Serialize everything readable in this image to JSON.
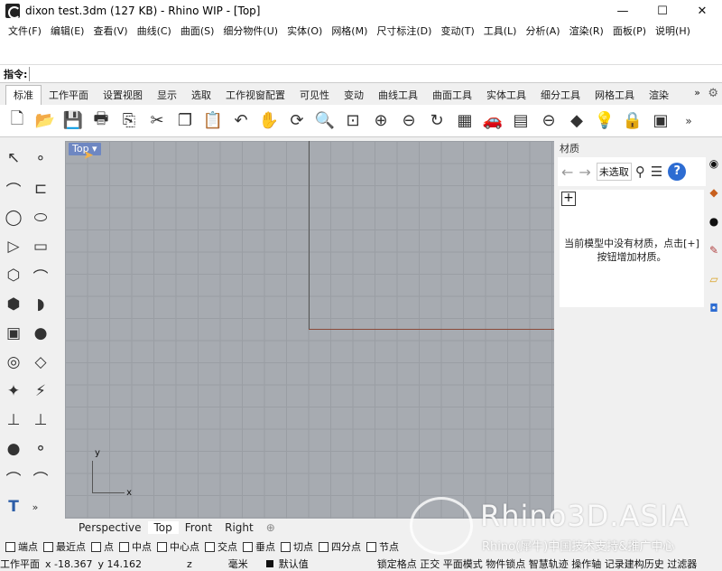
{
  "window": {
    "title": "dixon test.3dm (127 KB) - Rhino WIP - [Top]",
    "minimize": "—",
    "maximize": "☐",
    "close": "✕"
  },
  "menu": [
    "文件(F)",
    "编辑(E)",
    "查看(V)",
    "曲线(C)",
    "曲面(S)",
    "细分物件(U)",
    "实体(O)",
    "网格(M)",
    "尺寸标注(D)",
    "变动(T)",
    "工具(L)",
    "分析(A)",
    "渲染(R)",
    "面板(P)",
    "说明(H)"
  ],
  "command": {
    "label": "指令:",
    "value": ""
  },
  "tabs": [
    "标准",
    "工作平面",
    "设置视图",
    "显示",
    "选取",
    "工作视窗配置",
    "可见性",
    "变动",
    "曲线工具",
    "曲面工具",
    "实体工具",
    "细分工具",
    "网格工具",
    "渲染"
  ],
  "tabs_more": "»",
  "toolbar_icons": [
    "new-icon",
    "open-icon",
    "save-icon",
    "print-icon",
    "import-icon",
    "cut-icon",
    "copy-icon",
    "paste-icon",
    "undo-icon",
    "pan-icon",
    "rotate-icon",
    "zoom-icon",
    "zoom-window-icon",
    "zoom-extents-icon",
    "zoom-selected-icon",
    "rotate-view-icon",
    "viewport-layout-icon",
    "car-icon",
    "grid-icon",
    "cplane-icon",
    "object-props-icon",
    "light-icon",
    "lock-icon",
    "render-icon"
  ],
  "toolbar_glyphs": [
    "🗋",
    "📂",
    "💾",
    "🖶",
    "⎘",
    "✂",
    "❐",
    "📋",
    "↶",
    "✋",
    "⟳",
    "🔍",
    "⊡",
    "⊕",
    "⊖",
    "↻",
    "▦",
    "🚗",
    "▤",
    "⊖",
    "◆",
    "💡",
    "🔒",
    "▣"
  ],
  "left_tools": [
    "↖",
    "∘",
    "⌒",
    "⊏",
    "◯",
    "⬭",
    "▷",
    "▭",
    "⬡",
    "⌒",
    "⬢",
    "◗",
    "▣",
    "●",
    "◎",
    "◇",
    "✦",
    "⚡",
    "⊥",
    "⊥",
    "●",
    "⚬",
    "⌒",
    "⌒",
    "T",
    "»"
  ],
  "viewport": {
    "label": "Top",
    "axis_x": "x",
    "axis_y": "y"
  },
  "viewport_tabs": [
    "Perspective",
    "Top",
    "Front",
    "Right"
  ],
  "viewport_tab_add": "⊕",
  "panel": {
    "title": "材质",
    "selector": "未选取",
    "help": "?",
    "message": "当前模型中没有材质，点击[+]按钮增加材质。"
  },
  "osnaps": [
    "端点",
    "最近点",
    "点",
    "中点",
    "中心点",
    "交点",
    "垂点",
    "切点",
    "四分点",
    "节点"
  ],
  "status": {
    "cplane": "工作平面",
    "x": "x -18.367",
    "y": "y 14.162",
    "z": "z",
    "units": "毫米",
    "layer": "默认值",
    "modes": "锁定格点 正交 平面模式 物件锁点 智慧轨迹 操作轴 记录建构历史 过滤器"
  },
  "watermark": {
    "brand": "Rhino3D.ASIA",
    "tagline": "Rhino(犀牛)中国技术支持&推广中心"
  }
}
